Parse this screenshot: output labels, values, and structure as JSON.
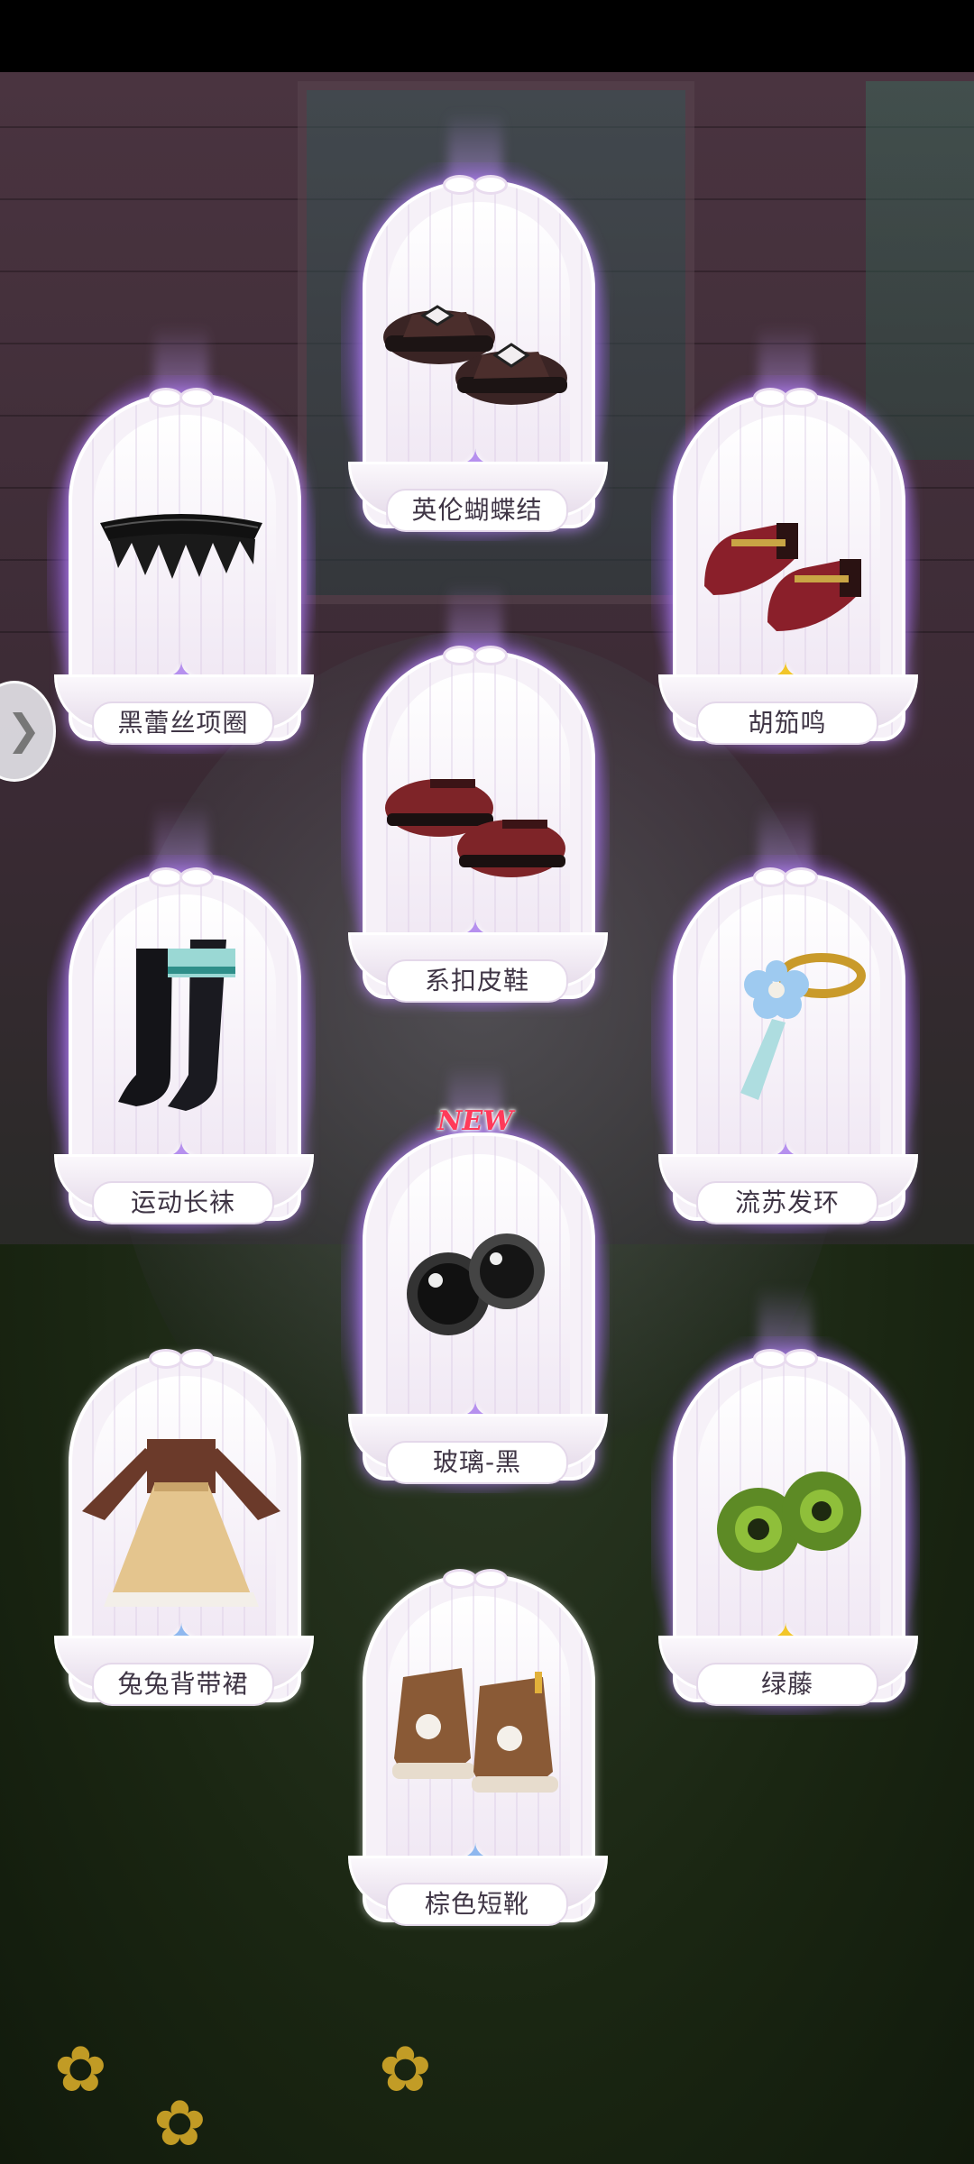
{
  "new_badge": "NEW",
  "side_button": {
    "icon": "chevron-right-icon",
    "glyph": "❯"
  },
  "items": [
    {
      "name": "英伦蝴蝶结",
      "rarity": "purple",
      "icon": "bow-loafers-icon"
    },
    {
      "name": "黑蕾丝项圈",
      "rarity": "purple",
      "icon": "lace-choker-icon"
    },
    {
      "name": "胡笳鸣",
      "rarity": "gold",
      "icon": "red-mary-jane-shoes-icon"
    },
    {
      "name": "系扣皮鞋",
      "rarity": "purple",
      "icon": "buckle-shoes-icon"
    },
    {
      "name": "运动长袜",
      "rarity": "purple",
      "icon": "long-socks-icon"
    },
    {
      "name": "流苏发环",
      "rarity": "purple",
      "icon": "tassel-hairpin-icon"
    },
    {
      "name": "玻璃-黑",
      "rarity": "purple",
      "icon": "black-glass-eyes-icon",
      "is_new": true
    },
    {
      "name": "兔兔背带裙",
      "rarity": "blue",
      "icon": "bunny-overall-dress-icon"
    },
    {
      "name": "绿藤",
      "rarity": "gold",
      "icon": "green-eyes-icon"
    },
    {
      "name": "棕色短靴",
      "rarity": "blue",
      "icon": "brown-boots-icon"
    }
  ],
  "colors": {
    "purple_glow": "#b078ff",
    "gem_purple": "#b690ee",
    "gem_gold": "#f2c62a",
    "gem_blue": "#8fb8ef"
  }
}
